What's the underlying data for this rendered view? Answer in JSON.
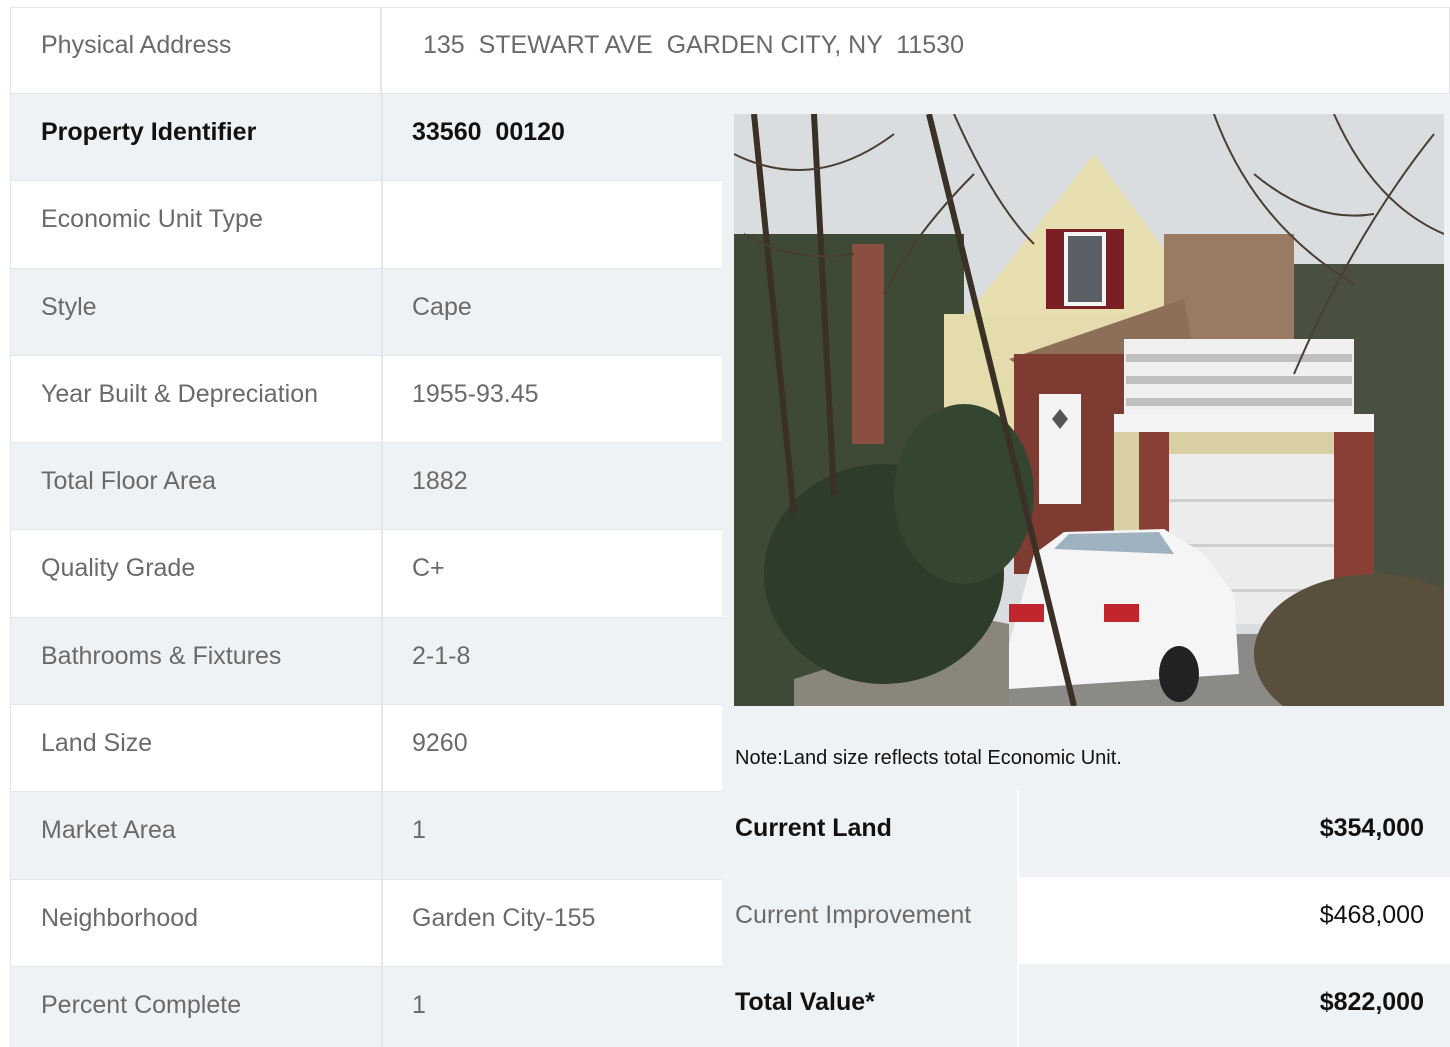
{
  "address": {
    "label": "Physical Address",
    "value": "135  STEWART AVE  GARDEN CITY, NY  11530"
  },
  "details": [
    {
      "label": "Property Identifier",
      "value": "33560  00120",
      "bold": true
    },
    {
      "label": "Economic Unit Type",
      "value": ""
    },
    {
      "label": "Style",
      "value": "Cape"
    },
    {
      "label": "Year Built & Depreciation",
      "value": "1955-93.45"
    },
    {
      "label": "Total Floor Area",
      "value": "1882"
    },
    {
      "label": "Quality Grade",
      "value": "C+"
    },
    {
      "label": "Bathrooms & Fixtures",
      "value": "2-1-8"
    },
    {
      "label": "Land Size",
      "value": "9260"
    },
    {
      "label": "Market Area",
      "value": "1"
    },
    {
      "label": "Neighborhood",
      "value": "Garden City-155"
    },
    {
      "label": "Percent Complete",
      "value": "1"
    }
  ],
  "note": "Note:Land size reflects total Economic Unit.",
  "valuation": {
    "current_land": {
      "label": "Current Land",
      "value": "$354,000"
    },
    "current_improvement": {
      "label": "Current Improvement",
      "value": "$468,000"
    },
    "total_value": {
      "label": "Total Value*",
      "value": "$822,000"
    }
  }
}
